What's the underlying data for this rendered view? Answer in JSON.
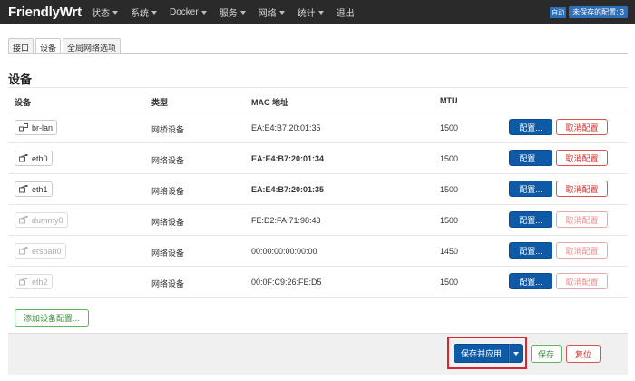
{
  "brand": "FriendlyWrt",
  "menu": [
    {
      "label": "状态",
      "has_caret": true
    },
    {
      "label": "系统",
      "has_caret": true
    },
    {
      "label": "Docker",
      "has_caret": true
    },
    {
      "label": "服务",
      "has_caret": true
    },
    {
      "label": "网络",
      "has_caret": true
    },
    {
      "label": "统计",
      "has_caret": true
    },
    {
      "label": "退出",
      "has_caret": false
    }
  ],
  "header_right": {
    "auto_badge": "自动",
    "unsaved_label": "未保存的配置: 3"
  },
  "tabs": [
    {
      "label": "接口",
      "active": false
    },
    {
      "label": "设备",
      "active": true
    },
    {
      "label": "全局网络选项",
      "active": false
    }
  ],
  "section_title": "设备",
  "table": {
    "headers": {
      "device": "设备",
      "type": "类型",
      "mac": "MAC 地址",
      "mtu": "MTU"
    },
    "rows": [
      {
        "device": "br-lan",
        "type": "网桥设备",
        "mac": "EA:E4:B7:20:01:35",
        "mtu": "1500",
        "mac_bold": false,
        "disabled": false,
        "icon": "bridge-icon"
      },
      {
        "device": "eth0",
        "type": "网络设备",
        "mac": "EA:E4:B7:20:01:34",
        "mtu": "1500",
        "mac_bold": true,
        "disabled": false,
        "icon": "ethernet-icon"
      },
      {
        "device": "eth1",
        "type": "网络设备",
        "mac": "EA:E4:B7:20:01:35",
        "mtu": "1500",
        "mac_bold": true,
        "disabled": false,
        "icon": "ethernet-icon"
      },
      {
        "device": "dummy0",
        "type": "网络设备",
        "mac": "FE:D2:FA:71:98:43",
        "mtu": "1500",
        "mac_bold": false,
        "disabled": true,
        "icon": "ethernet-icon"
      },
      {
        "device": "erspan0",
        "type": "网络设备",
        "mac": "00:00:00:00:00:00",
        "mtu": "1450",
        "mac_bold": false,
        "disabled": true,
        "icon": "ethernet-icon"
      },
      {
        "device": "eth2",
        "type": "网络设备",
        "mac": "00:0F:C9:26:FE:D5",
        "mtu": "1500",
        "mac_bold": false,
        "disabled": true,
        "icon": "ethernet-icon"
      }
    ],
    "configure_label": "配置...",
    "unconfigure_label": "取消配置"
  },
  "add_button": "添加设备配置...",
  "footer": {
    "save_apply": "保存并应用",
    "save": "保存",
    "reset": "复位"
  },
  "colors": {
    "navbar": "#2a2a2a",
    "primary": "#0e5aa7",
    "danger": "#d9534f",
    "success": "#5cb85c",
    "highlight": "#d9252b"
  }
}
